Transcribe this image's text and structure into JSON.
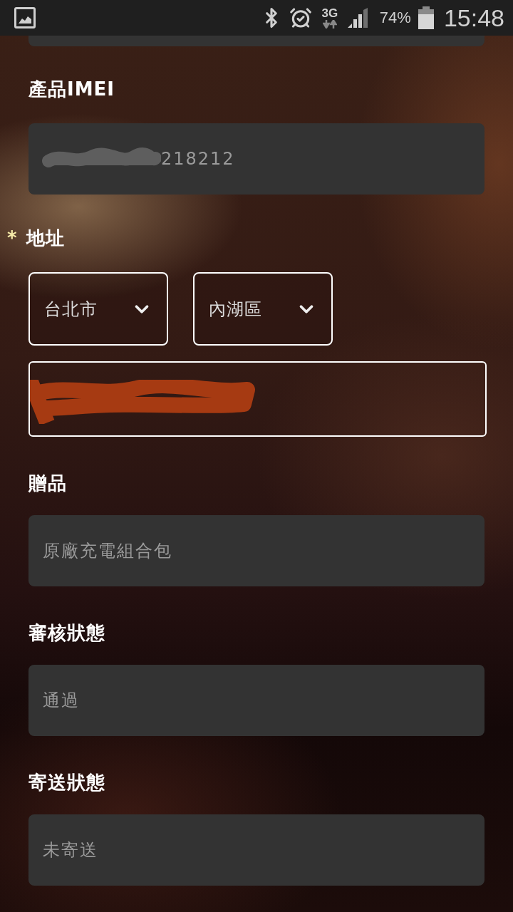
{
  "status_bar": {
    "network_type": "3G",
    "battery_percent": "74%",
    "time": "15:48"
  },
  "form": {
    "fields": [
      {
        "kind": "cut_off"
      },
      {
        "kind": "text",
        "label": "產品IMEI",
        "value": "218212",
        "redacted": true
      },
      {
        "kind": "address",
        "required_mark": "*",
        "label": "地址",
        "selects": [
          {
            "value": "台北市"
          },
          {
            "value": "內湖區"
          }
        ],
        "redacted": true
      },
      {
        "kind": "text",
        "label": "贈品",
        "value": "原廠充電組合包",
        "redacted": false
      },
      {
        "kind": "text",
        "label": "審核狀態",
        "value": "通過",
        "redacted": false
      },
      {
        "kind": "text",
        "label": "寄送狀態",
        "value": "未寄送",
        "redacted": false
      }
    ]
  }
}
